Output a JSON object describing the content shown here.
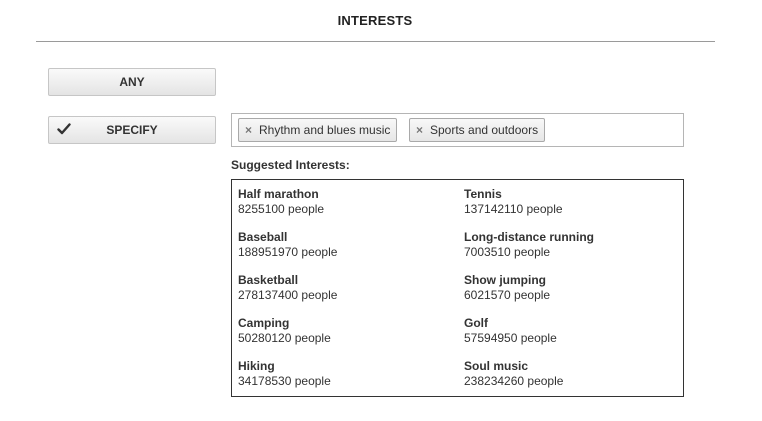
{
  "header": {
    "title": "INTERESTS"
  },
  "options": {
    "any_label": "ANY",
    "specify_label": "SPECIFY"
  },
  "selected_tags": [
    {
      "label": "Rhythm and blues music"
    },
    {
      "label": "Sports and outdoors"
    }
  ],
  "suggestions": {
    "label": "Suggested Interests:",
    "items": [
      {
        "name": "Half marathon",
        "count": "8255100 people"
      },
      {
        "name": "Tennis",
        "count": "137142110 people"
      },
      {
        "name": "Baseball",
        "count": "188951970 people"
      },
      {
        "name": "Long-distance running",
        "count": "7003510 people"
      },
      {
        "name": "Basketball",
        "count": "278137400 people"
      },
      {
        "name": "Show jumping",
        "count": "6021570 people"
      },
      {
        "name": "Camping",
        "count": "50280120 people"
      },
      {
        "name": "Golf",
        "count": "57594950 people"
      },
      {
        "name": "Hiking",
        "count": "34178530 people"
      },
      {
        "name": "Soul music",
        "count": "238234260 people"
      }
    ]
  },
  "icons": {
    "check": "checkmark-icon",
    "remove": "remove-x-icon"
  }
}
